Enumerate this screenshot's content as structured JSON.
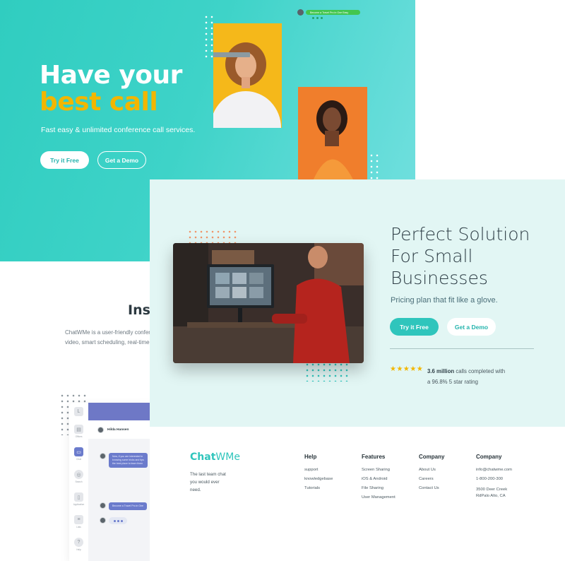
{
  "hero": {
    "title_line1": "Have your",
    "title_line2": "best call",
    "subtitle": "Fast easy & unlimited conference call services.",
    "try_label": "Try it Free",
    "demo_label": "Get a Demo",
    "chat_pill": "Become a Travel Pro in One Easy",
    "colors": {
      "bg": "#3ed3c8",
      "accent": "#f2b600"
    }
  },
  "features": {
    "title": "Inst",
    "text_line1": "ChatWMe is a user-friendly confere",
    "text_line2": "video, smart scheduling, real-time"
  },
  "app": {
    "user_name": "Hilda Hansen",
    "sidebar": [
      {
        "icon": "home-icon",
        "label": ""
      },
      {
        "icon": "office-icon",
        "label": "Offices"
      },
      {
        "icon": "chat-icon",
        "label": "Chat"
      },
      {
        "icon": "search-icon",
        "label": "Search"
      },
      {
        "icon": "document-icon",
        "label": "Application"
      },
      {
        "icon": "list-icon",
        "label": "Lists"
      },
      {
        "icon": "help-icon",
        "label": "Help"
      }
    ],
    "messages": [
      "Now, if you are interested in",
      "knowing some tricks and tips",
      "the best place to learn them",
      "Become a Travel Pro in One"
    ]
  },
  "solution": {
    "title_line1": "Perfect Solution",
    "title_line2": "For Small",
    "title_line3": "Businesses",
    "subtitle": "Pricing plan that fit like a glove.",
    "try_label": "Try it Free",
    "demo_label": "Get a Demo",
    "stars": "★★★★★",
    "rating_bold": "3.6 million",
    "rating_rest": "calls completed with",
    "rating_line2": "a 96.8% 5 star rating"
  },
  "footer": {
    "brand_bold": "Chat",
    "brand_rest": "WMe",
    "tagline": "The last team chat you would ever need.",
    "columns": [
      {
        "heading": "Help",
        "links": [
          "support",
          "knowledgebase",
          "Tutorials"
        ]
      },
      {
        "heading": "Features",
        "links": [
          "Screen Sharing",
          "iOS & Android",
          "File Sharing",
          "User Management"
        ]
      },
      {
        "heading": "Company",
        "links": [
          "About Us",
          "Careers",
          "Contact Us"
        ]
      },
      {
        "heading": "Company",
        "links": [
          "info@chatwme.com",
          "1-800-200-300",
          "3500 Deer Creek",
          "RdPalo Alto, CA"
        ]
      }
    ]
  }
}
